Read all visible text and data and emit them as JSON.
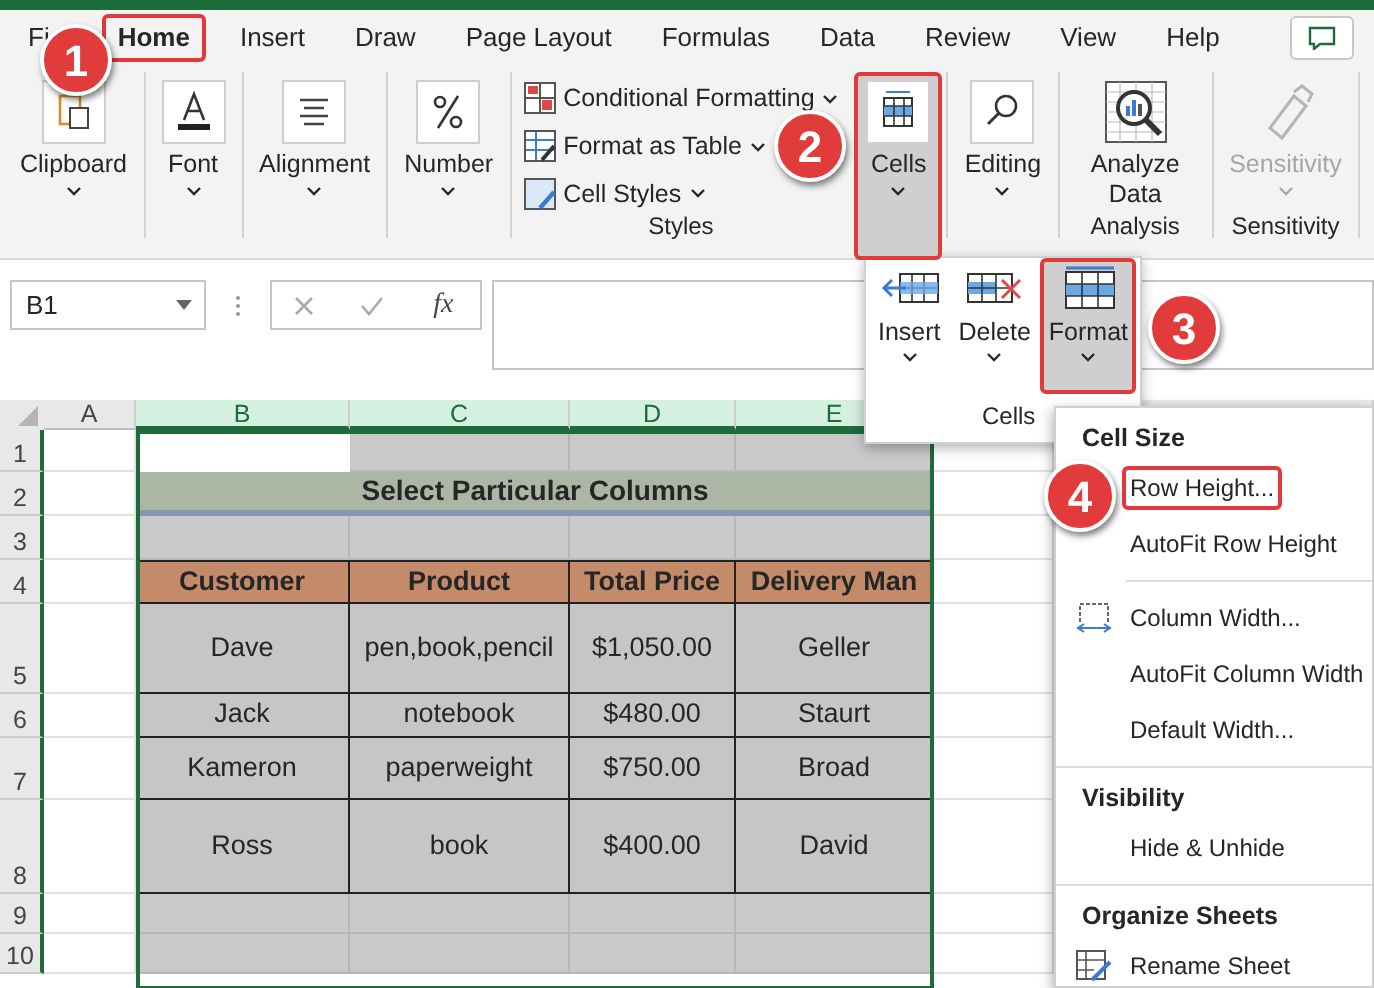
{
  "tabs": [
    {
      "label": "Fi",
      "selected": false,
      "outlined": false
    },
    {
      "label": "Home",
      "selected": true,
      "outlined": true
    },
    {
      "label": "Insert",
      "selected": false,
      "outlined": false
    },
    {
      "label": "Draw",
      "selected": false,
      "outlined": false
    },
    {
      "label": "Page Layout",
      "selected": false,
      "outlined": false
    },
    {
      "label": "Formulas",
      "selected": false,
      "outlined": false
    },
    {
      "label": "Data",
      "selected": false,
      "outlined": false
    },
    {
      "label": "Review",
      "selected": false,
      "outlined": false
    },
    {
      "label": "View",
      "selected": false,
      "outlined": false
    },
    {
      "label": "Help",
      "selected": false,
      "outlined": false
    }
  ],
  "ribbon": [
    {
      "buttons": [
        {
          "label": "Clipboard",
          "expanded": false,
          "disabled": false,
          "outlined": false
        }
      ]
    },
    {
      "buttons": [
        {
          "label": "Font",
          "expanded": false,
          "disabled": false,
          "outlined": false
        }
      ]
    },
    {
      "buttons": [
        {
          "label": "Alignment",
          "expanded": false,
          "disabled": false,
          "outlined": false
        }
      ]
    },
    {
      "buttons": [
        {
          "label": "Number",
          "expanded": false,
          "disabled": false,
          "outlined": false
        }
      ]
    },
    {
      "name": "Styles",
      "buttons": [
        {
          "label": "Conditional Formatting",
          "disabled": false,
          "outlined": false
        },
        {
          "label": "Format as Table",
          "disabled": false,
          "outlined": false
        },
        {
          "label": "Cell Styles",
          "disabled": false,
          "outlined": false
        }
      ]
    },
    {
      "buttons": [
        {
          "label": "Cells",
          "expanded": true,
          "disabled": false,
          "outlined": true
        }
      ]
    },
    {
      "buttons": [
        {
          "label": "Editing",
          "expanded": false,
          "disabled": false,
          "outlined": false
        }
      ]
    },
    {
      "name": "Analysis",
      "buttons": [
        {
          "label": "Analyze Data",
          "expanded": false,
          "disabled": false,
          "outlined": false
        }
      ]
    },
    {
      "name": "Sensitivity",
      "buttons": [
        {
          "label": "Sensitivity",
          "expanded": false,
          "disabled": true,
          "outlined": false
        }
      ]
    }
  ],
  "formula_bar": {
    "name_box": "B1",
    "function_label": "fx"
  },
  "sheet": {
    "columns": [
      {
        "label": "A",
        "selected": false
      },
      {
        "label": "B",
        "selected": true
      },
      {
        "label": "C",
        "selected": true
      },
      {
        "label": "D",
        "selected": true
      },
      {
        "label": "E",
        "selected": true
      }
    ],
    "rows": [
      "1",
      "2",
      "3",
      "4",
      "5",
      "6",
      "7",
      "8",
      "9",
      "10"
    ],
    "title": "Select Particular Columns",
    "headers": [
      "Customer",
      "Product",
      "Total Price",
      "Delivery Man"
    ],
    "records": [
      [
        "Dave",
        "pen,book,pencil",
        "$1,050.00",
        "Geller"
      ],
      [
        "Jack",
        "notebook",
        "$480.00",
        "Staurt"
      ],
      [
        "Kameron",
        "paperweight",
        "$750.00",
        "Broad"
      ],
      [
        "Ross",
        "book",
        "$400.00",
        "David"
      ]
    ]
  },
  "cells_dropdown": {
    "name": "Cells",
    "buttons": [
      {
        "label": "Insert",
        "expanded": false,
        "outlined": false
      },
      {
        "label": "Delete",
        "expanded": false,
        "outlined": false
      },
      {
        "label": "Format",
        "expanded": true,
        "outlined": true
      }
    ]
  },
  "format_menu": [
    {
      "heading": "Cell Size",
      "items": [
        {
          "label": "Row Height...",
          "outlined": true
        },
        {
          "label": "AutoFit Row Height",
          "outlined": false
        },
        {
          "label": "Column Width...",
          "outlined": false
        },
        {
          "label": "AutoFit Column Width",
          "outlined": false
        },
        {
          "label": "Default Width...",
          "outlined": false
        }
      ]
    },
    {
      "heading": "Visibility",
      "items": [
        {
          "label": "Hide & Unhide",
          "outlined": false
        }
      ]
    },
    {
      "heading": "Organize Sheets",
      "items": [
        {
          "label": "Rename Sheet",
          "outlined": false
        }
      ]
    }
  ],
  "callouts": [
    "1",
    "2",
    "3",
    "4"
  ]
}
